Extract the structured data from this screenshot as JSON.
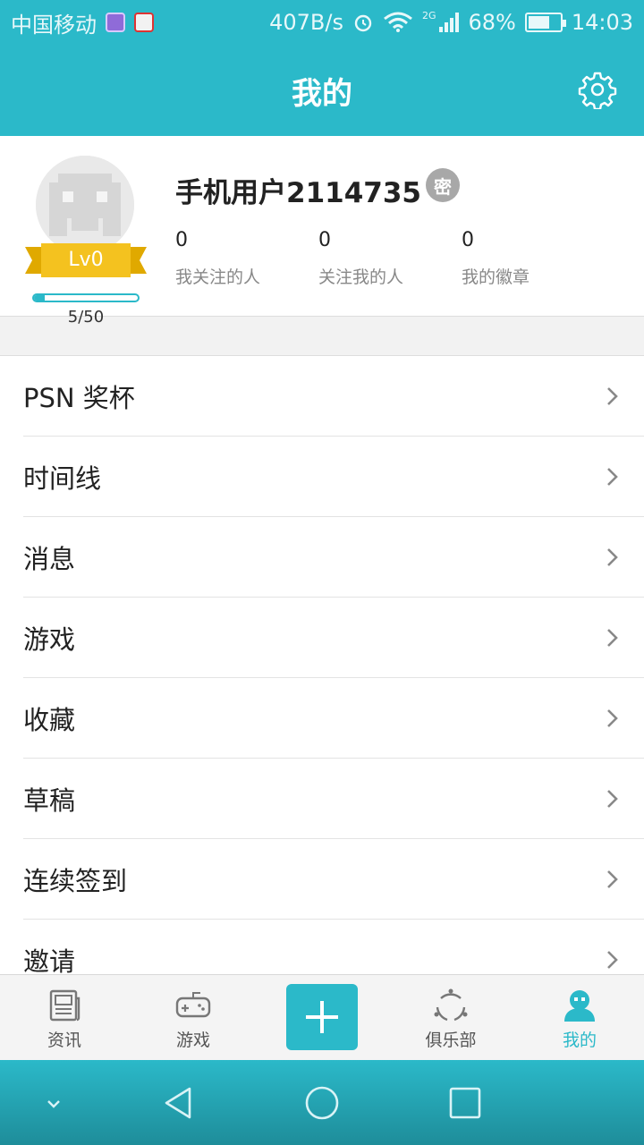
{
  "status_bar": {
    "carrier": "中国移动",
    "speed": "407B/s",
    "network": "2G",
    "battery": "68%",
    "battery_level": 0.68,
    "time": "14:03"
  },
  "header": {
    "title": "我的"
  },
  "profile": {
    "username": "手机用户2114735",
    "secret_badge": "密",
    "level": "Lv0",
    "exp_text": "5/50",
    "exp_fraction": 0.1,
    "stats": [
      {
        "value": "0",
        "label": "我关注的人"
      },
      {
        "value": "0",
        "label": "关注我的人"
      },
      {
        "value": "0",
        "label": "我的徽章"
      }
    ]
  },
  "menu": {
    "items": [
      {
        "label": "PSN 奖杯"
      },
      {
        "label": "时间线"
      },
      {
        "label": "消息"
      },
      {
        "label": "游戏"
      },
      {
        "label": "收藏"
      },
      {
        "label": "草稿"
      },
      {
        "label": "连续签到"
      },
      {
        "label": "邀请"
      }
    ]
  },
  "tabs": [
    {
      "label": "资讯",
      "icon": "news-icon"
    },
    {
      "label": "游戏",
      "icon": "gamepad-icon"
    },
    {
      "label": "",
      "icon": "plus-icon"
    },
    {
      "label": "俱乐部",
      "icon": "club-icon"
    },
    {
      "label": "我的",
      "icon": "profile-icon",
      "active": true
    }
  ],
  "colors": {
    "accent": "#2bb9c9",
    "level_gold": "#f4c21f"
  }
}
